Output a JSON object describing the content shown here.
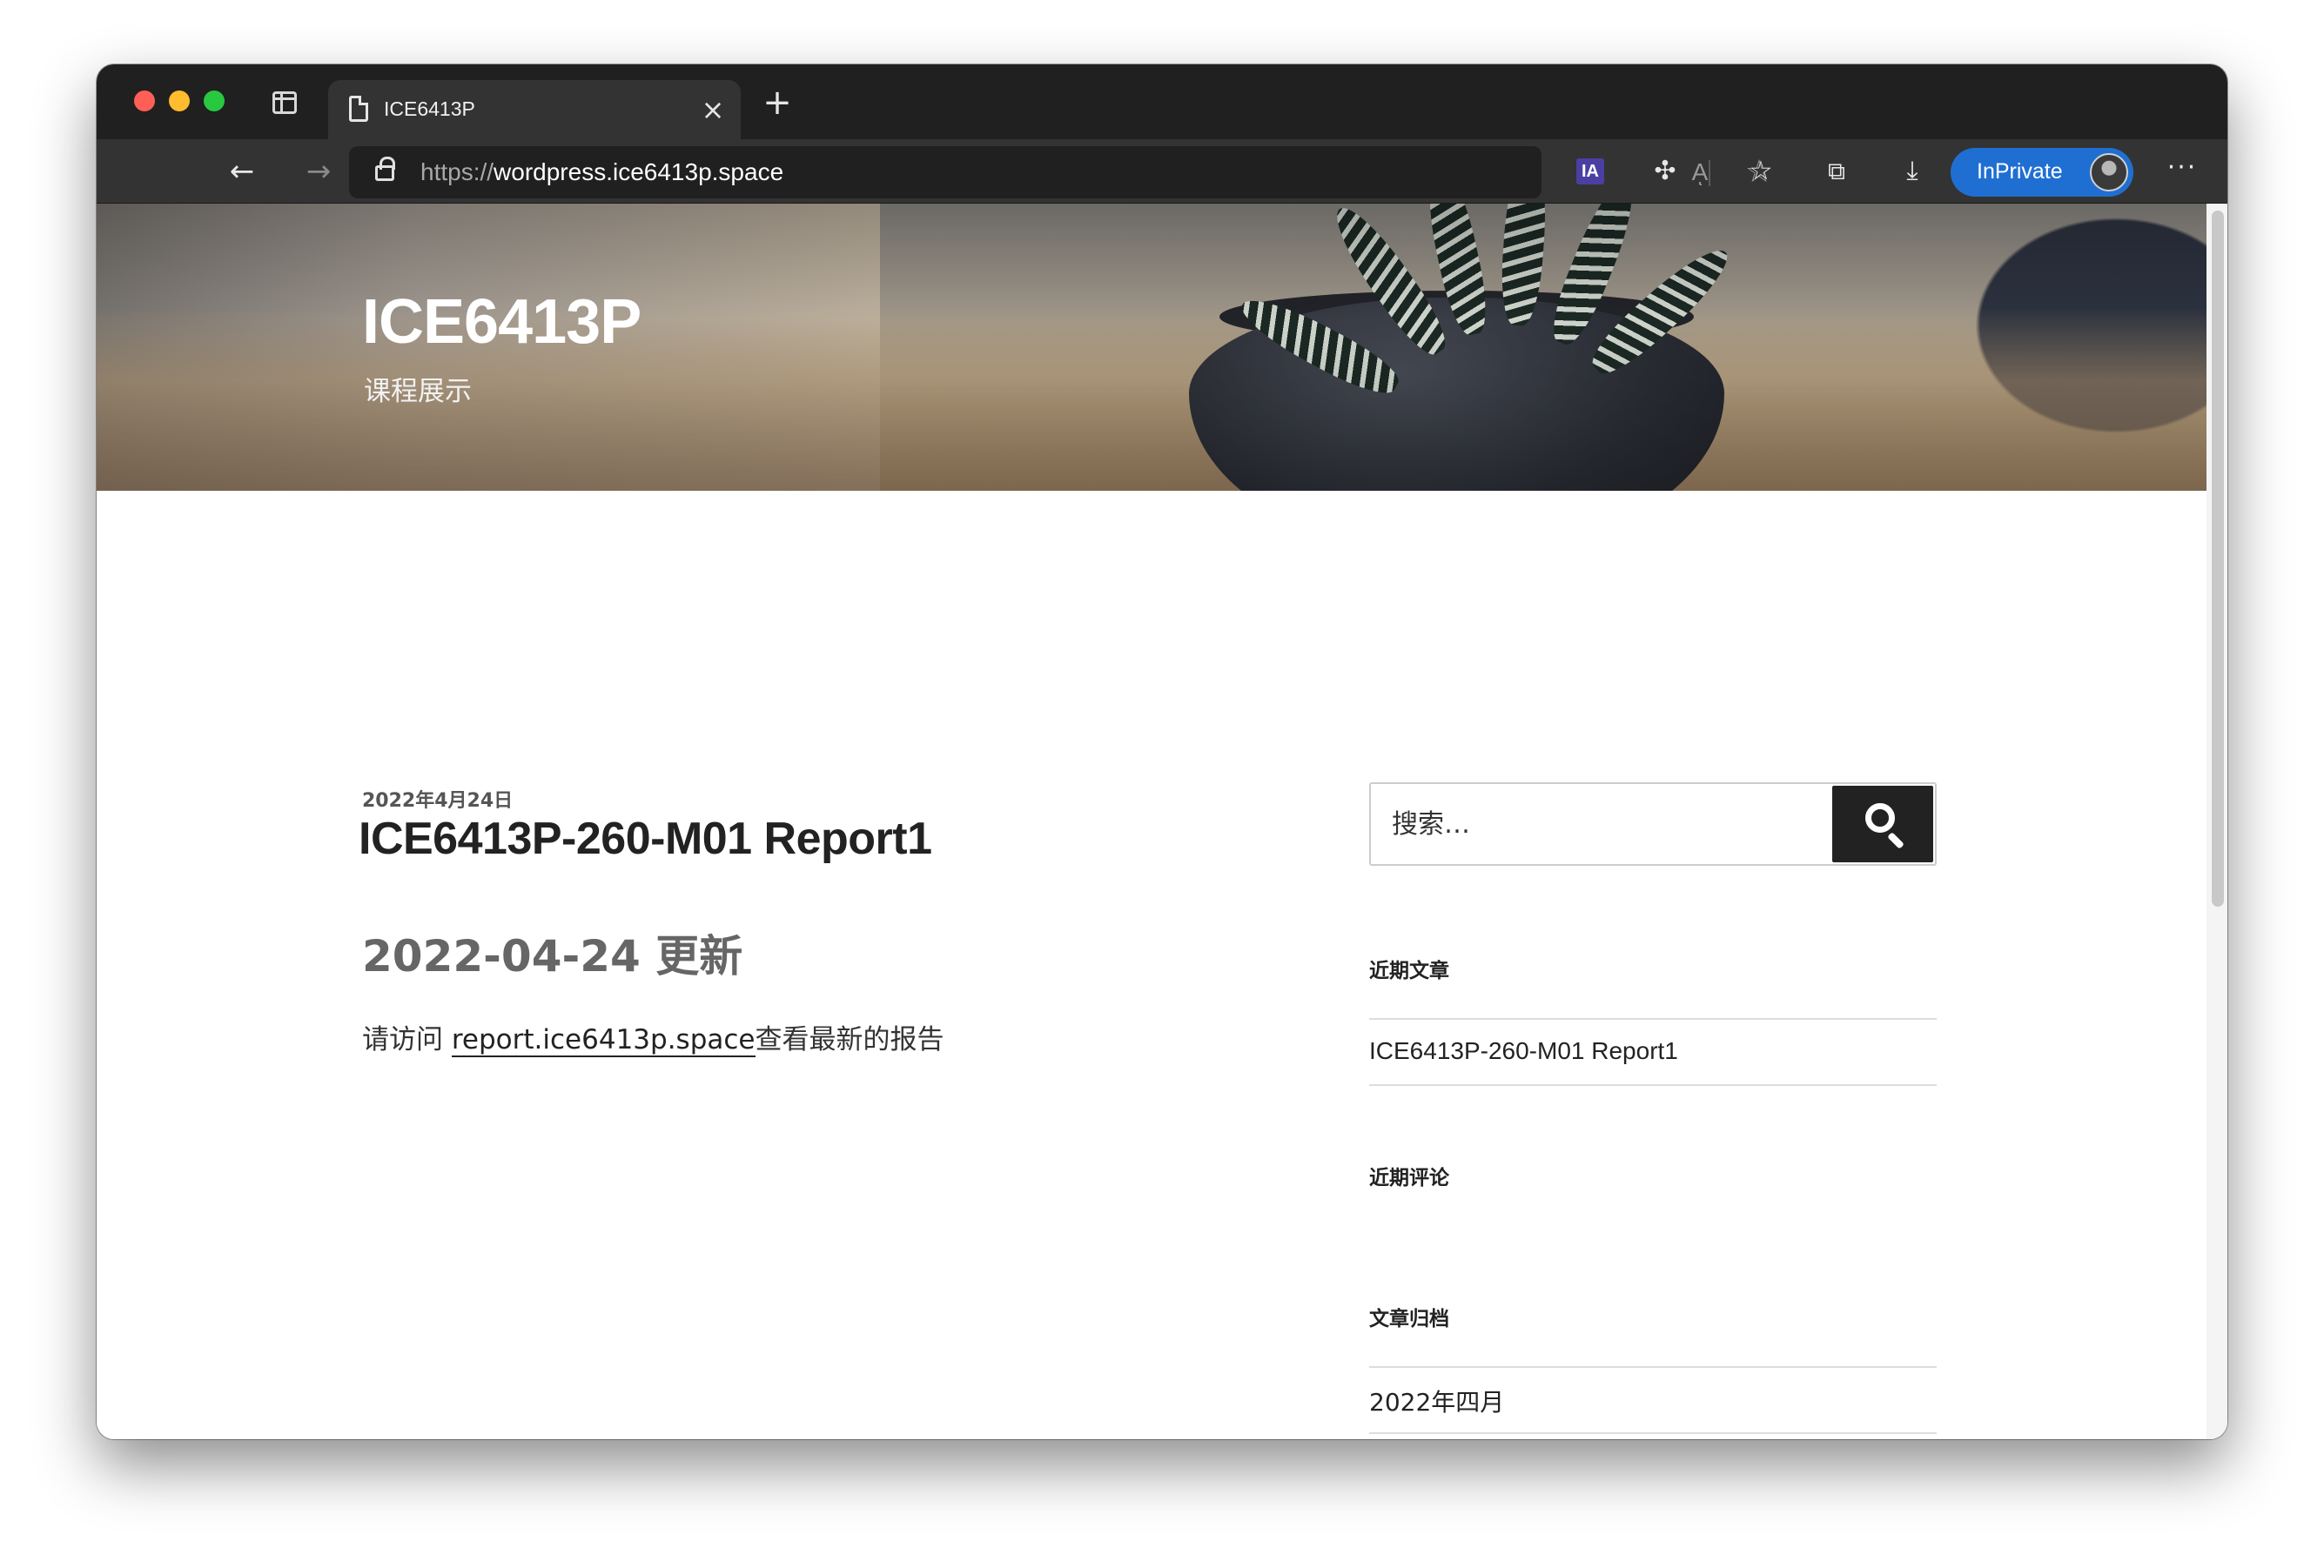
{
  "browser": {
    "tab_title": "ICE6413P",
    "url_scheme": "https://",
    "url_host": "wordpress.ice6413p.space",
    "read_aloud": "Aͅ",
    "extension_label": "IA",
    "inprivate_label": "InPrivate",
    "icons": {
      "back": "back-arrow-icon",
      "forward": "forward-arrow-icon",
      "refresh": "refresh-icon",
      "favorites": "favorites-icon",
      "collections": "collections-icon",
      "downloads": "download-icon",
      "more": "more-icon"
    }
  },
  "site": {
    "title": "ICE6413P",
    "tagline": "课程展示"
  },
  "post": {
    "date": "2022年4月24日",
    "title": "ICE6413P-260-M01 Report1",
    "heading": "2022-04-24 更新",
    "body_prefix": "请访问 ",
    "link_text": "report.ice6413p.space",
    "body_suffix": "查看最新的报告"
  },
  "sidebar": {
    "search_placeholder": "搜索…",
    "recent_posts_title": "近期文章",
    "recent_posts": [
      "ICE6413P-260-M01 Report1"
    ],
    "recent_comments_title": "近期评论",
    "archives_title": "文章归档",
    "archives": [
      "2022年四月"
    ]
  }
}
